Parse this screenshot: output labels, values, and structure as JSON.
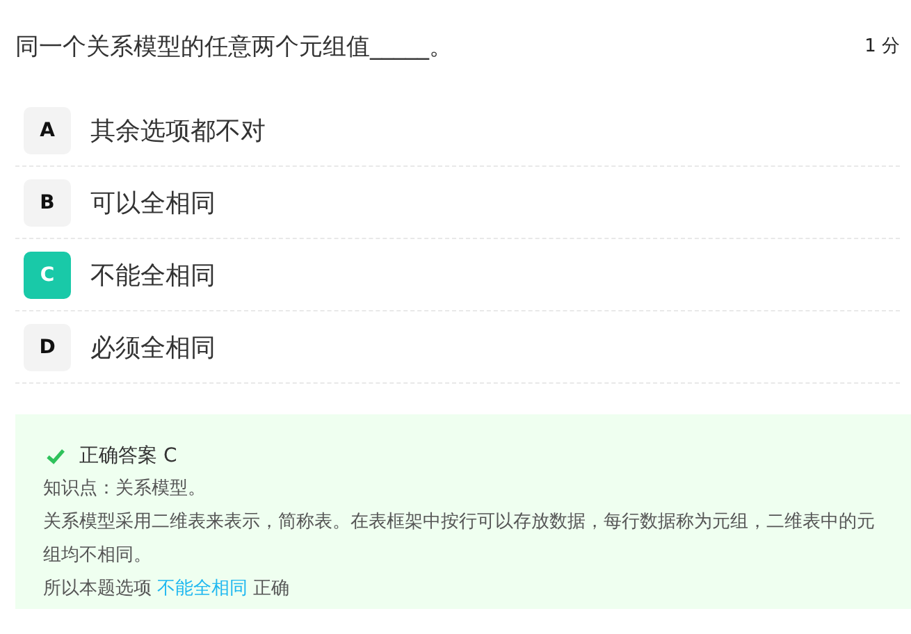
{
  "question": {
    "text": "同一个关系模型的任意两个元组值_____。",
    "score": "1 分"
  },
  "options": [
    {
      "letter": "A",
      "text": "其余选项都不对",
      "selected": false
    },
    {
      "letter": "B",
      "text": "可以全相同",
      "selected": false
    },
    {
      "letter": "C",
      "text": "不能全相同",
      "selected": true
    },
    {
      "letter": "D",
      "text": "必须全相同",
      "selected": false
    }
  ],
  "analysis": {
    "answer": "正确答案 C",
    "knowledge": "知识点：关系模型。",
    "explanation": "关系模型采用二维表来表示，简称表。在表框架中按行可以存放数据，每行数据称为元组，二维表中的元组均不相同。",
    "conclusion_prefix": "所以本题选项",
    "conclusion_option": "不能全相同",
    "conclusion_suffix": "正确"
  }
}
